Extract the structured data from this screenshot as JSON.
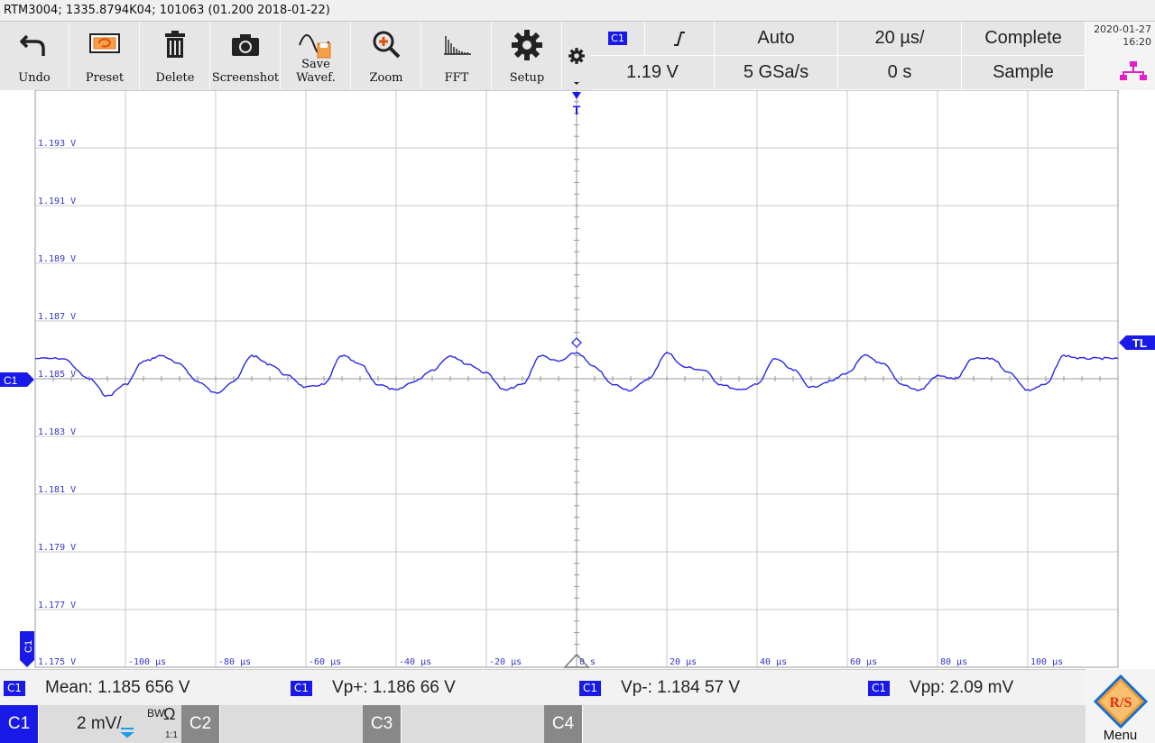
{
  "title": "RTM3004; 1335.8794K04; 101063 (01.200 2018-01-22)",
  "toolbar": [
    {
      "label": "Undo",
      "icon": "undo-icon"
    },
    {
      "label": "Preset",
      "icon": "preset-icon"
    },
    {
      "label": "Delete",
      "icon": "trash-icon"
    },
    {
      "label": "Screenshot",
      "icon": "camera-icon"
    },
    {
      "label": "Save Wavef.",
      "icon": "save-waveform-icon"
    },
    {
      "label": "Zoom",
      "icon": "zoom-icon"
    },
    {
      "label": "FFT",
      "icon": "fft-icon"
    },
    {
      "label": "Setup",
      "icon": "gear-icon"
    }
  ],
  "trigger": {
    "source": "C1",
    "slope_icon": "rising-edge-icon",
    "level": "1.19 V",
    "mode": "Auto",
    "sample_rate": "5 GSa/s",
    "timebase": "20 µs/",
    "offset": "0 s",
    "acq_state": "Complete",
    "acq_mode": "Sample"
  },
  "datetime": {
    "date": "2020-01-27",
    "time": "16:20"
  },
  "plot": {
    "y_labels": [
      "1.193 V",
      "1.191 V",
      "1.189 V",
      "1.187 V",
      "1.185 V",
      "1.183 V",
      "1.181 V",
      "1.179 V",
      "1.177 V",
      "1.175 V"
    ],
    "x_labels": [
      "-100 µs",
      "-80 µs",
      "-60 µs",
      "-40 µs",
      "-20 µs",
      "0 s",
      "20 µs",
      "40 µs",
      "60 µs",
      "80 µs",
      "100 µs"
    ],
    "ch_marker": "C1",
    "trigger_marker": "T",
    "trigger_level_marker": "TL",
    "ch_side_marker": "C1",
    "colors": {
      "trace": "#2828e6",
      "grid": "#c8c8c8",
      "axis": "#999999",
      "label": "#3333cc"
    }
  },
  "chart_data": {
    "type": "line",
    "x_unit": "µs",
    "y_unit": "V",
    "xlim": [
      -120,
      120
    ],
    "ylim": [
      1.175,
      1.195
    ],
    "x": [
      -120,
      -114,
      -108,
      -104,
      -100,
      -96,
      -92,
      -88,
      -84,
      -80,
      -76,
      -72,
      -68,
      -64,
      -60,
      -56,
      -52,
      -48,
      -44,
      -40,
      -36,
      -32,
      -28,
      -24,
      -20,
      -16,
      -12,
      -8,
      -4,
      0,
      4,
      8,
      12,
      16,
      20,
      24,
      28,
      32,
      36,
      40,
      44,
      48,
      52,
      56,
      60,
      64,
      68,
      72,
      76,
      80,
      84,
      88,
      92,
      96,
      100,
      104,
      108,
      112,
      116,
      120
    ],
    "y": [
      1.1857,
      1.1857,
      1.185,
      1.1844,
      1.1848,
      1.1856,
      1.1858,
      1.1855,
      1.1849,
      1.1845,
      1.1849,
      1.1858,
      1.1855,
      1.1851,
      1.1847,
      1.1848,
      1.1858,
      1.1855,
      1.1848,
      1.1846,
      1.1849,
      1.1853,
      1.1858,
      1.1855,
      1.1852,
      1.1846,
      1.1848,
      1.1858,
      1.1856,
      1.1859,
      1.1854,
      1.1848,
      1.1846,
      1.185,
      1.1859,
      1.1854,
      1.1853,
      1.1848,
      1.1846,
      1.1848,
      1.1857,
      1.1853,
      1.1847,
      1.1849,
      1.1852,
      1.1858,
      1.1855,
      1.1848,
      1.1846,
      1.1851,
      1.185,
      1.1857,
      1.1857,
      1.1852,
      1.1846,
      1.1848,
      1.1858,
      1.1857,
      1.1857,
      1.1857
    ]
  },
  "measurements": [
    {
      "badge": "C1",
      "label": "Mean: 1.185 656 V"
    },
    {
      "badge": "C1",
      "label": "Vp+: 1.186 66 V"
    },
    {
      "badge": "C1",
      "label": "Vp-: 1.184 57 V"
    },
    {
      "badge": "C1",
      "label": "Vpp: 2.09 mV"
    }
  ],
  "channels": [
    {
      "name": "C1",
      "scale": "2 mV/",
      "bw": "BW",
      "ohm": "Ω",
      "ratio": "1:1",
      "color": "#1a1ae8"
    },
    {
      "name": "C2",
      "color": "#888888"
    },
    {
      "name": "C3",
      "color": "#888888"
    },
    {
      "name": "C4",
      "color": "#888888"
    }
  ],
  "menu_label": "Menu"
}
